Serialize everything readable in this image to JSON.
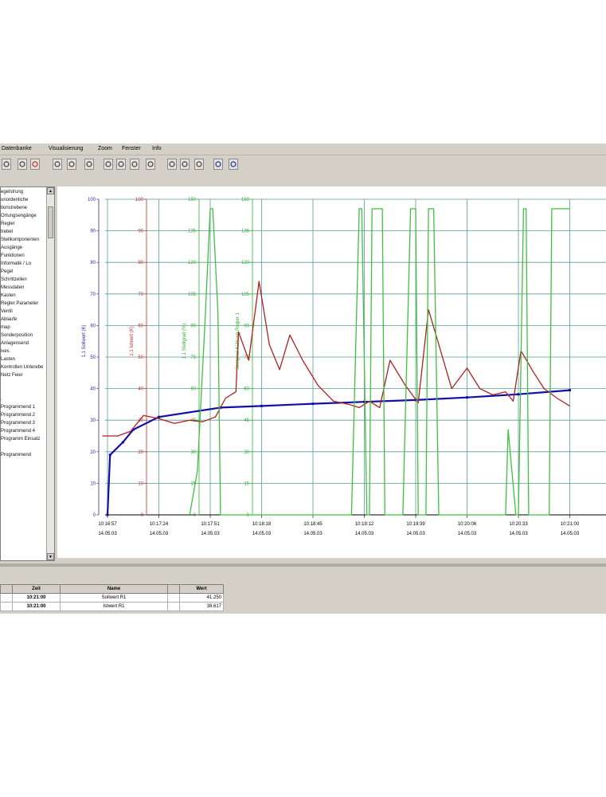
{
  "menu": [
    "Datenbanke",
    "Visualisierung",
    "Zoom",
    "Fenster",
    "Info"
  ],
  "toolbar_icons": [
    "save-icon",
    "print-icon",
    "stop-icon",
    "ruler-icon",
    "scissors-icon",
    "export-icon",
    "zoom-in-icon",
    "zoom-out-icon",
    "zoom-area-icon",
    "marker-icon",
    "zoom-fit-icon",
    "zoom-reset-icon",
    "copy-icon",
    "window-tile-icon",
    "window-cascade-icon"
  ],
  "tree_items": [
    "egelstrung",
    "unordenliche",
    "tionstrebene",
    "Ortungsengänge",
    "Regler",
    "trebel",
    "Stellkomponenten",
    "Ausgänge",
    "Funktionen",
    "Informatik / Lo",
    "Pegel",
    "Schrittzellen",
    "Messdaten",
    "Kasten",
    "Regler Parameter",
    "Ventil",
    "Ablaufe",
    "map",
    "Sonderposition",
    "Anlagensend",
    "ives",
    "Lasten",
    "Kontrollen Unterebe",
    "Netz Feier",
    "",
    "",
    ".",
    "Programmend 1",
    "Programmend 2",
    "Programmend 3",
    "Programmend 4",
    "Programm Einsatz",
    "",
    "Programmend"
  ],
  "chart_data": {
    "type": "line",
    "x_ticks": [
      {
        "time": "10:16:57",
        "date": "14.05.03"
      },
      {
        "time": "10:17:24",
        "date": "14.05.03"
      },
      {
        "time": "10:17:51",
        "date": "14.05.03"
      },
      {
        "time": "10:18:18",
        "date": "14.05.03"
      },
      {
        "time": "10:18:45",
        "date": "14.05.03"
      },
      {
        "time": "10:19:12",
        "date": "14.05.03"
      },
      {
        "time": "10:19:39",
        "date": "14.05.03"
      },
      {
        "time": "10:20:06",
        "date": "14.05.03"
      },
      {
        "time": "10:20:33",
        "date": "14.05.03"
      },
      {
        "time": "10:21:00",
        "date": "14.05.03"
      }
    ],
    "axes": [
      {
        "color": "#2a2ab0",
        "ticks": [
          "100",
          "90",
          "80",
          "70",
          "60",
          "50",
          "40",
          "30",
          "20",
          "10",
          "0"
        ],
        "label": "1.1 Sollwert (K)"
      },
      {
        "color": "#c03030",
        "ticks": [
          "100",
          "90",
          "80",
          "70",
          "60",
          "50",
          "40",
          "30",
          "20",
          "10",
          "0"
        ],
        "label": "1.1 Istwert (K)"
      },
      {
        "color": "#30b030",
        "ticks": [
          "150",
          "135",
          "120",
          "105",
          "90",
          "75",
          "60",
          "45",
          "30",
          "15",
          "0"
        ],
        "label": "1.1 Stellgrad (%)"
      },
      {
        "color": "#30b030",
        "ticks": [
          "150",
          "135",
          "120",
          "105",
          "90",
          "75",
          "60",
          "45",
          "30",
          "15",
          "0"
        ],
        "label": "Stellgrad Kühlung Regler 1"
      }
    ],
    "ylim": [
      0,
      100
    ],
    "series": [
      {
        "name": "1.1 Sollwert (K)",
        "color": "#1010a8",
        "x": [
          0,
          0.05,
          0.3,
          0.5,
          1.0,
          2.2,
          3.0,
          4.0,
          5.0,
          6.0,
          7.0,
          8.0,
          9.0
        ],
        "y": [
          0,
          19,
          23,
          27,
          31,
          34,
          34.5,
          35.2,
          35.8,
          36.4,
          37.2,
          38.2,
          39.5
        ]
      },
      {
        "name": "1.1 Istwert (K)",
        "color": "#b02020",
        "x": [
          -0.1,
          0.2,
          0.45,
          0.7,
          1.0,
          1.3,
          1.6,
          1.85,
          2.1,
          2.3,
          2.5,
          2.55,
          2.75,
          2.95,
          3.15,
          3.35,
          3.55,
          3.8,
          4.1,
          4.4,
          4.7,
          4.9,
          5.1,
          5.3,
          5.5,
          5.8,
          6.05,
          6.25,
          6.45,
          6.7,
          7.0,
          7.25,
          7.5,
          7.75,
          7.9,
          8.05,
          8.3,
          8.5,
          8.75,
          9.0
        ],
        "y": [
          25,
          25,
          26.5,
          31.5,
          30.5,
          29,
          30,
          29.5,
          31,
          37,
          39,
          58,
          49,
          74,
          54,
          46,
          57,
          49,
          41,
          36,
          35,
          34,
          36,
          34,
          49,
          41,
          35.5,
          65,
          54,
          40,
          46.5,
          40,
          38,
          39,
          36,
          52,
          45,
          40,
          37,
          34.5
        ]
      },
      {
        "name": "1.1 Stellgrad (%)",
        "color": "#40c040",
        "x": [
          1.6,
          1.75,
          1.9,
          2.0,
          2.05,
          2.15,
          2.2,
          2.3,
          2.35,
          2.4,
          4.6,
          4.75,
          4.9,
          4.95,
          5.05,
          5.1,
          5.15,
          5.2,
          5.3,
          5.35,
          5.4,
          5.45,
          5.55,
          5.75,
          5.9,
          6.0,
          6.05,
          6.2,
          6.25,
          6.35,
          6.45,
          7.75,
          7.8,
          7.95,
          8.0,
          8.1,
          8.15,
          8.2,
          8.3,
          8.45,
          8.55,
          8.6,
          8.65,
          8.75,
          8.95,
          9.0
        ],
        "y": [
          0,
          14,
          62,
          97,
          97,
          64,
          0,
          0,
          0,
          0,
          0,
          0,
          97,
          97,
          0,
          0,
          97,
          97,
          97,
          97,
          0,
          0,
          0,
          0,
          97,
          97,
          0,
          0,
          97,
          97,
          0,
          0,
          27,
          0,
          0,
          97,
          97,
          0,
          0,
          0,
          0,
          0,
          97,
          97,
          97,
          97
        ]
      }
    ]
  },
  "table": {
    "headers": [
      "",
      "Zeit",
      "Name",
      "",
      "Wert"
    ],
    "rows": [
      [
        "",
        "10:21:00",
        "Sollwert R1",
        "",
        "41.250"
      ],
      [
        "",
        "10:21:00",
        "Istwert R1",
        "",
        "38.617"
      ]
    ]
  }
}
